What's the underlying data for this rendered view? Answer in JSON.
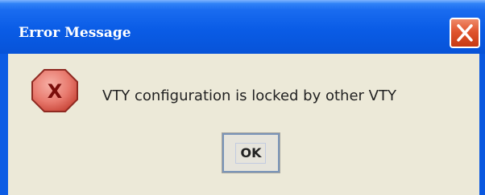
{
  "window": {
    "title": "Error Message",
    "close_icon": "close-icon"
  },
  "dialog": {
    "icon": "error-icon",
    "message": "VTY configuration is locked by other VTY",
    "ok_label": "OK"
  },
  "colors": {
    "titlebar": "#0a5ce6",
    "close_button": "#e0552e",
    "client_background": "#ece9d8",
    "error_icon_fill": "#e87a6e"
  }
}
